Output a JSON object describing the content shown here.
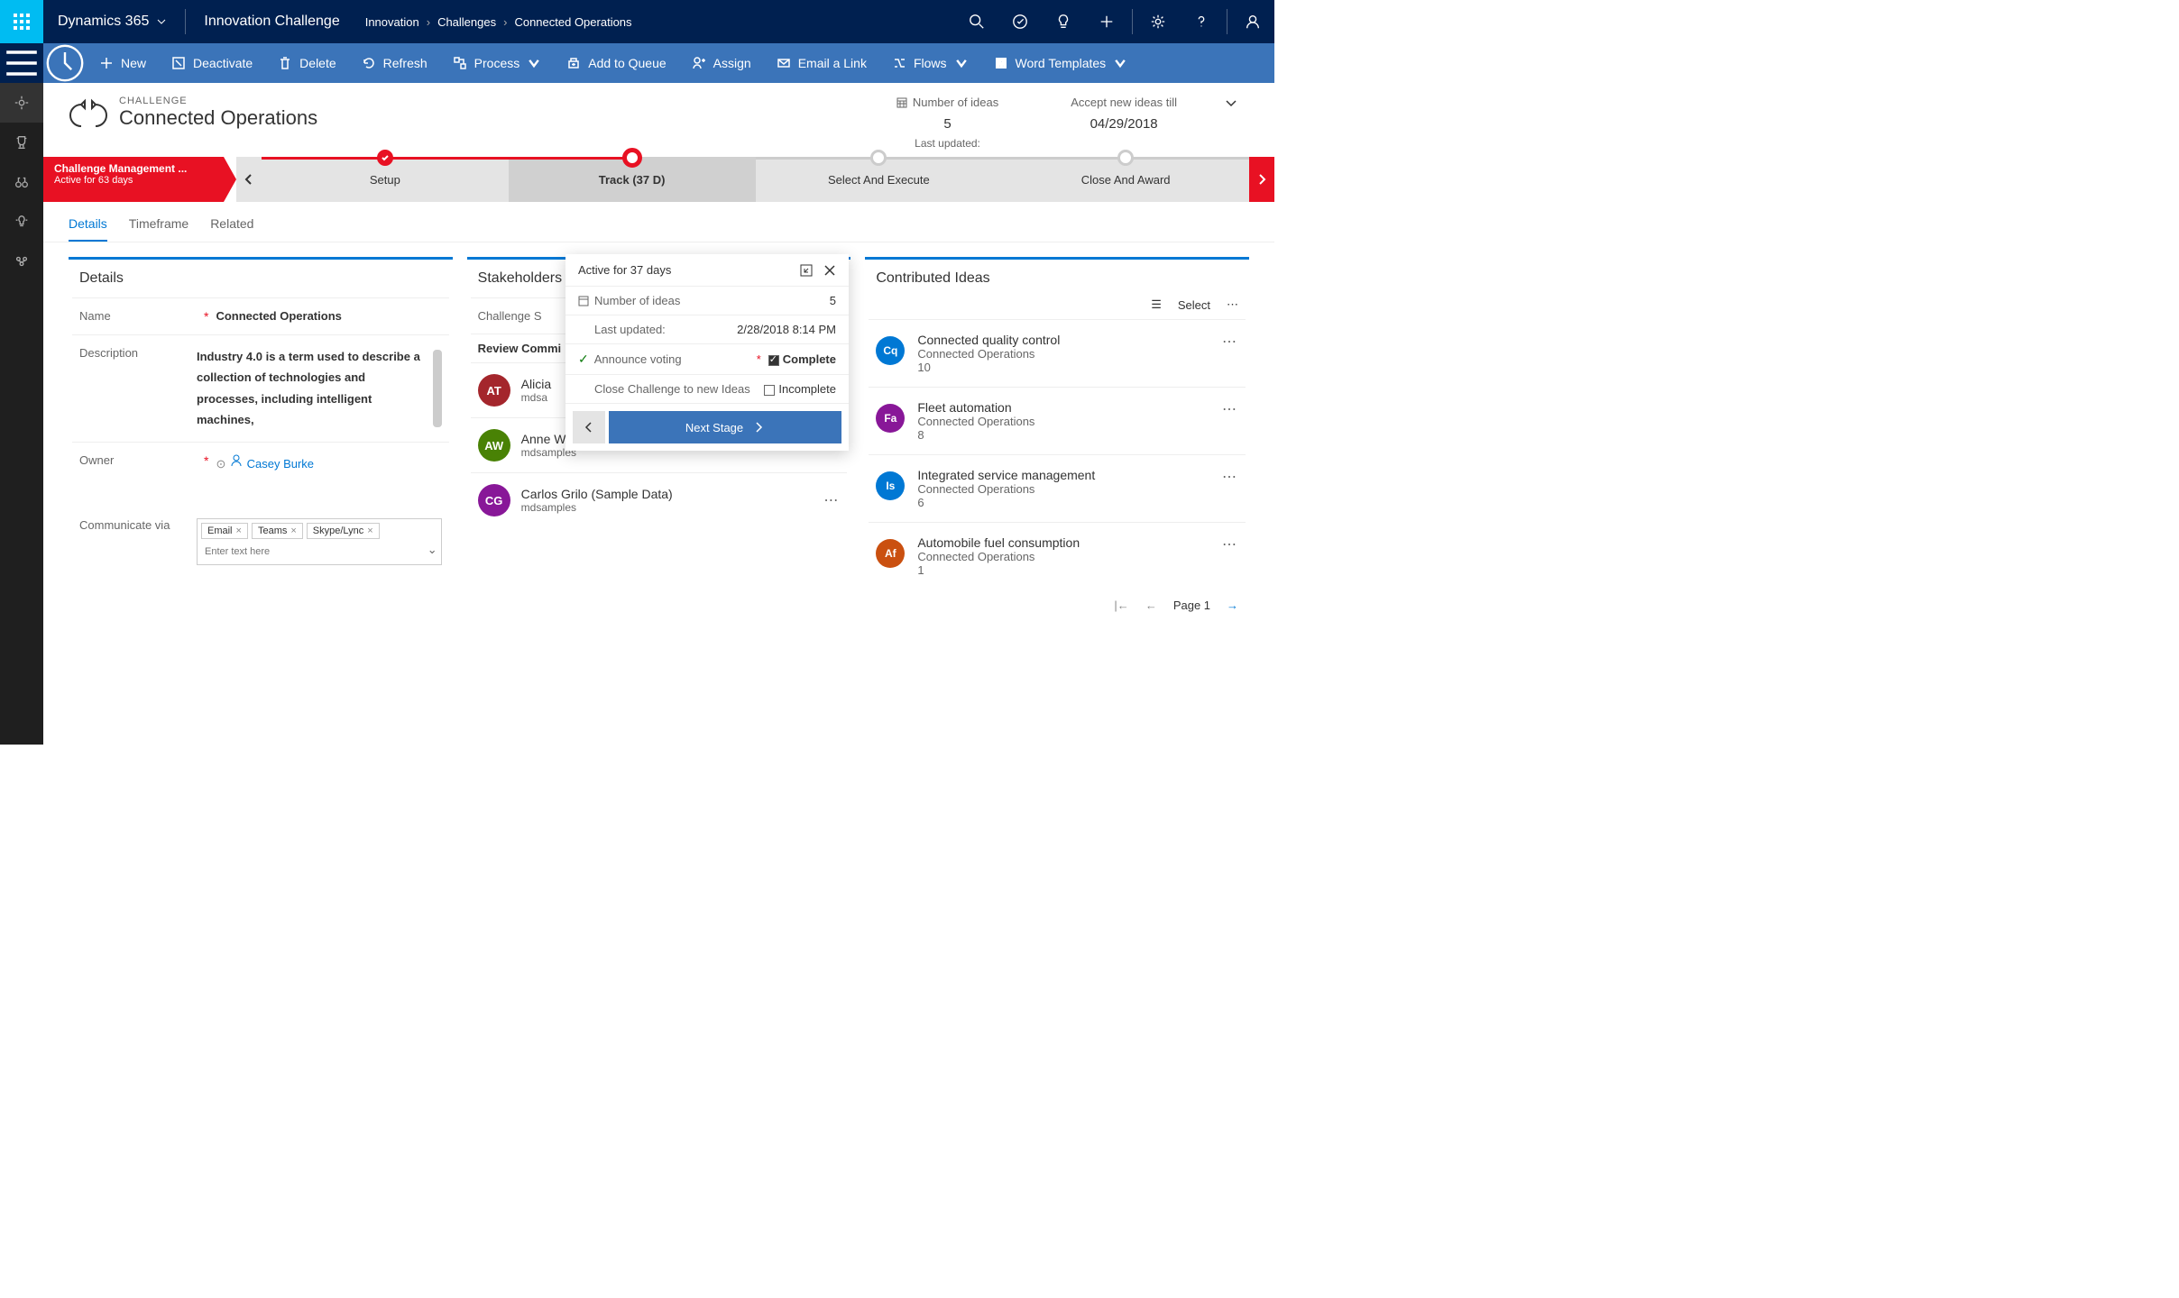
{
  "topbar": {
    "brand": "Dynamics 365",
    "area": "Innovation Challenge",
    "breadcrumbs": [
      "Innovation",
      "Challenges",
      "Connected Operations"
    ]
  },
  "commands": {
    "new": "New",
    "deactivate": "Deactivate",
    "delete": "Delete",
    "refresh": "Refresh",
    "process": "Process",
    "add_queue": "Add to Queue",
    "assign": "Assign",
    "email_link": "Email a Link",
    "flows": "Flows",
    "word_templates": "Word Templates"
  },
  "page": {
    "label": "CHALLENGE",
    "title": "Connected Operations",
    "num_ideas_label": "Number of ideas",
    "num_ideas": "5",
    "accept_label": "Accept new ideas till",
    "accept_date": "04/29/2018",
    "last_updated_label": "Last updated:"
  },
  "process": {
    "badge_title": "Challenge Management ...",
    "badge_sub": "Active for 63 days",
    "stages": {
      "setup": "Setup",
      "track": "Track  (37 D)",
      "select": "Select And Execute",
      "close": "Close And Award"
    }
  },
  "tabs": {
    "details": "Details",
    "timeframe": "Timeframe",
    "related": "Related"
  },
  "details": {
    "section": "Details",
    "name_label": "Name",
    "name_value": "Connected Operations",
    "desc_label": "Description",
    "desc_value": "Industry 4.0 is a term used to describe a collection of technologies and processes, including intelligent machines,",
    "owner_label": "Owner",
    "owner_value": "Casey Burke",
    "comm_label": "Communicate via",
    "comm_tags": [
      "Email",
      "Teams",
      "Skype/Lync"
    ],
    "comm_placeholder": "Enter text here"
  },
  "stakeholders": {
    "section": "Stakeholders",
    "sponsor_label": "Challenge S",
    "review_label": "Review Commi",
    "people": [
      {
        "initials": "AT",
        "name": "Alicia",
        "org": "mdsa",
        "color": "#a4262c"
      },
      {
        "initials": "AW",
        "name": "Anne Weiler (Sample Data)",
        "org": "mdsamples",
        "color": "#498205"
      },
      {
        "initials": "CG",
        "name": "Carlos Grilo (Sample Data)",
        "org": "mdsamples",
        "color": "#881798"
      }
    ]
  },
  "ideas": {
    "section": "Contributed Ideas",
    "select_label": "Select",
    "items": [
      {
        "initials": "Cq",
        "title": "Connected quality control",
        "sub": "Connected Operations",
        "count": "10",
        "color": "#0078d4"
      },
      {
        "initials": "Fa",
        "title": "Fleet automation",
        "sub": "Connected Operations",
        "count": "8",
        "color": "#881798"
      },
      {
        "initials": "Is",
        "title": "Integrated service management",
        "sub": "Connected Operations",
        "count": "6",
        "color": "#0078d4"
      },
      {
        "initials": "Af",
        "title": "Automobile fuel consumption",
        "sub": "Connected Operations",
        "count": "1",
        "color": "#ca5010"
      }
    ],
    "page_label": "Page 1"
  },
  "popover": {
    "active": "Active for 37 days",
    "num_ideas_label": "Number of ideas",
    "num_ideas": "5",
    "last_upd_label": "Last updated:",
    "last_upd": "2/28/2018 8:14 PM",
    "announce_label": "Announce voting",
    "announce_value": "Complete",
    "close_label": "Close Challenge to new Ideas",
    "close_value": "Incomplete",
    "next": "Next Stage"
  }
}
